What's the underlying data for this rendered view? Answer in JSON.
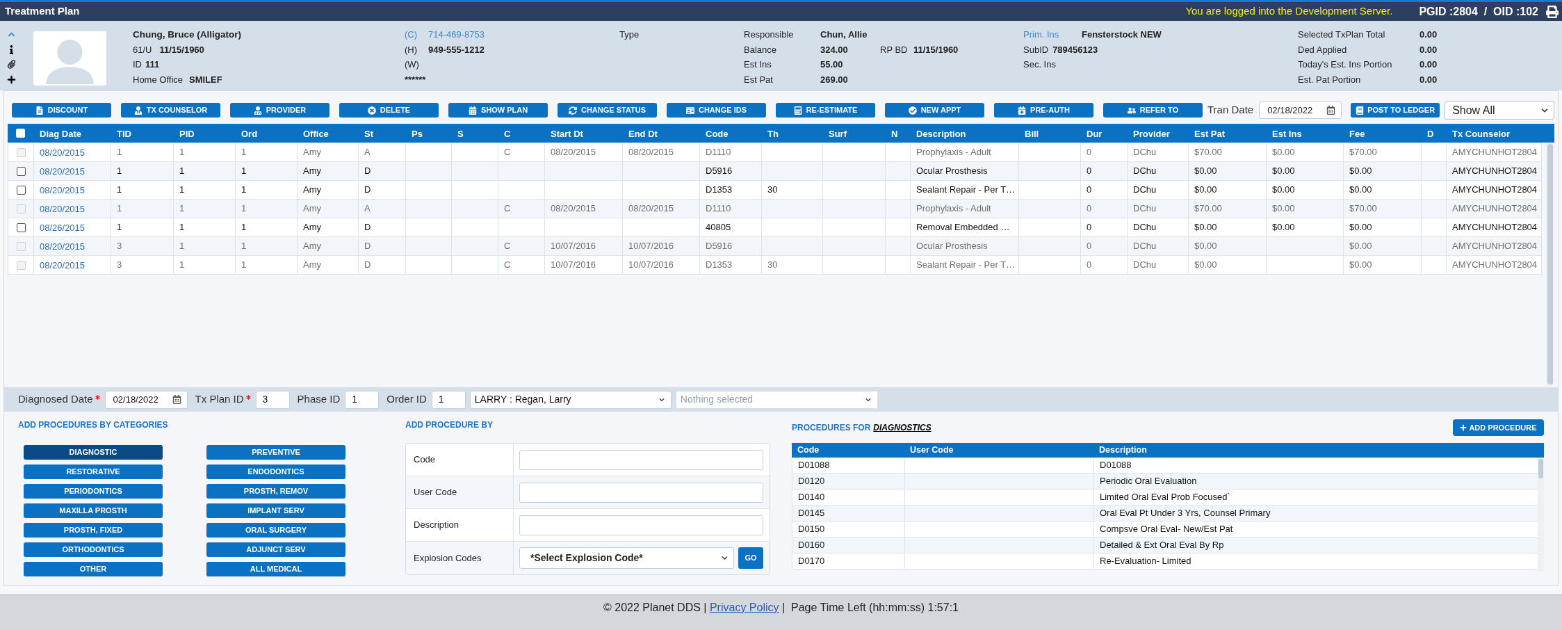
{
  "window": {
    "title": "Treatment Plan",
    "server_notice": "You are logged into the Development Server.",
    "ids": "PGID :2804  /  OID :102"
  },
  "patient": {
    "name": "Chung, Bruce (Alligator)",
    "age": "61/U",
    "dob": "11/15/1960",
    "id_label": "ID",
    "id": "111",
    "office_label": "Home Office",
    "office": "SMILEF"
  },
  "phones": [
    {
      "label": "(C)",
      "value": "714-469-8753",
      "kind": "link"
    },
    {
      "label": "(H)",
      "value": "949-555-1212",
      "kind": "text"
    },
    {
      "label": "(W)",
      "kind": "text"
    },
    {
      "value": "******",
      "kind": "text"
    }
  ],
  "type_label": "Type",
  "account": [
    {
      "label": "Responsible",
      "value": "Chun, Allie"
    },
    {
      "label": "Balance",
      "value": "324.00",
      "extra_label": "RP BD",
      "extra_value": "11/15/1960"
    },
    {
      "label": "Est Ins",
      "value": "55.00"
    },
    {
      "label": "Est Pat",
      "value": "269.00"
    }
  ],
  "insurance": [
    {
      "label": "Prim. Ins",
      "value": "Fensterstock NEW",
      "kind": "link"
    },
    {
      "label": "SubID",
      "value": "789456123",
      "kind": "text"
    },
    {
      "label": "Sec. Ins",
      "kind": "text"
    }
  ],
  "totals": [
    {
      "label": "Selected TxPlan Total",
      "value": "0.00"
    },
    {
      "label": "Ded Applied",
      "value": "0.00"
    },
    {
      "label": "Today's Est. Ins Portion",
      "value": "0.00"
    },
    {
      "label": "Est. Pat Portion",
      "value": "0.00"
    }
  ],
  "toolbar": {
    "buttons": [
      "DISCOUNT",
      "TX COUNSELOR",
      "PROVIDER",
      "DELETE",
      "SHOW PLAN",
      "CHANGE STATUS",
      "CHANGE IDS",
      "RE-ESTIMATE",
      "NEW APPT",
      "PRE-AUTH",
      "REFER TO"
    ],
    "tran_date_label": "Tran Date",
    "tran_date": "02/18/2022",
    "post_button": "POST TO LEDGER",
    "filter": "Show All"
  },
  "table": {
    "select_all": {
      "checked": false
    },
    "columns": [
      "Diag Date",
      "TID",
      "PID",
      "Ord",
      "Office",
      "St",
      "Ps",
      "S",
      "C",
      "Start Dt",
      "End Dt",
      "Code",
      "Th",
      "Surf",
      "N",
      "Description",
      "Bill",
      "Dur",
      "Provider",
      "Est Pat",
      "Est Ins",
      "Fee",
      "D",
      "Tx Counselor"
    ],
    "rows": [
      {
        "checked": false,
        "disabled": true,
        "diag_date": "08/20/2015",
        "tid": "1",
        "pid": "1",
        "ord": "1",
        "office": "Amy",
        "st": "A",
        "c": "C",
        "start_dt": "08/20/2015",
        "end_dt": "08/20/2015",
        "code": "D1110",
        "description": "Prophylaxis - Adult",
        "dur": "0",
        "provider": "DChu",
        "est_pat": "$70.00",
        "est_ins": "$0.00",
        "fee": "$70.00",
        "tx_counselor": "AMYCHUNHOT2804"
      },
      {
        "checked": false,
        "disabled": false,
        "diag_date": "08/20/2015",
        "tid": "1",
        "pid": "1",
        "ord": "1",
        "office": "Amy",
        "st": "D",
        "code": "D5916",
        "description": "Ocular Prosthesis",
        "dur": "0",
        "provider": "DChu",
        "est_pat": "$0.00",
        "est_ins": "$0.00",
        "fee": "$0.00",
        "tx_counselor": "AMYCHUNHOT2804"
      },
      {
        "checked": false,
        "disabled": false,
        "diag_date": "08/20/2015",
        "tid": "1",
        "pid": "1",
        "ord": "1",
        "office": "Amy",
        "st": "D",
        "code": "D1353",
        "th": "30",
        "description": "Sealant Repair - Per T…",
        "dur": "0",
        "provider": "DChu",
        "est_pat": "$0.00",
        "est_ins": "$0.00",
        "fee": "$0.00",
        "tx_counselor": "AMYCHUNHOT2804"
      },
      {
        "checked": false,
        "disabled": true,
        "diag_date": "08/20/2015",
        "tid": "1",
        "pid": "1",
        "ord": "1",
        "office": "Amy",
        "st": "A",
        "c": "C",
        "start_dt": "08/20/2015",
        "end_dt": "08/20/2015",
        "code": "D1110",
        "description": "Prophylaxis - Adult",
        "dur": "0",
        "provider": "DChu",
        "est_pat": "$70.00",
        "est_ins": "$0.00",
        "fee": "$70.00",
        "tx_counselor": "AMYCHUNHOT2804"
      },
      {
        "checked": false,
        "disabled": false,
        "diag_date": "08/26/2015",
        "tid": "1",
        "pid": "1",
        "ord": "1",
        "office": "Amy",
        "st": "D",
        "code": "40805",
        "description": "Removal Embedded …",
        "dur": "0",
        "provider": "DChu",
        "est_pat": "$0.00",
        "est_ins": "$0.00",
        "fee": "$0.00",
        "tx_counselor": "AMYCHUNHOT2804"
      },
      {
        "checked": false,
        "disabled": true,
        "diag_date": "08/20/2015",
        "tid": "3",
        "pid": "1",
        "ord": "1",
        "office": "Amy",
        "st": "D",
        "c": "C",
        "start_dt": "10/07/2016",
        "end_dt": "10/07/2016",
        "code": "D5916",
        "description": "Ocular Prosthesis",
        "dur": "0",
        "provider": "DChu",
        "est_pat": "$0.00",
        "fee": "$0.00",
        "tx_counselor": "AMYCHUNHOT2804"
      },
      {
        "checked": false,
        "disabled": true,
        "diag_date": "08/20/2015",
        "tid": "3",
        "pid": "1",
        "ord": "1",
        "office": "Amy",
        "st": "D",
        "c": "C",
        "start_dt": "10/07/2016",
        "end_dt": "10/07/2016",
        "code": "D1353",
        "th": "30",
        "description": "Sealant Repair - Per T…",
        "dur": "0",
        "provider": "DChu",
        "est_pat": "$0.00",
        "fee": "$0.00",
        "tx_counselor": "AMYCHUNHOT2804"
      }
    ]
  },
  "diag_bar": {
    "fields": [
      {
        "label": "Diagnosed Date",
        "required": true,
        "value": "02/18/2022",
        "kind": "date"
      },
      {
        "label": "Tx Plan ID",
        "required": true,
        "value": "3",
        "kind": "text"
      },
      {
        "label": "Phase ID",
        "value": "1",
        "kind": "text"
      },
      {
        "label": "Order ID",
        "value": "1",
        "kind": "text"
      }
    ],
    "provider": "LARRY : Regan, Larry",
    "secondary_placeholder": "Nothing selected"
  },
  "categories": {
    "title": "ADD PROCEDURES BY CATEGORIES",
    "items": [
      {
        "label": "DIAGNOSTIC",
        "selected": true
      },
      {
        "label": "PREVENTIVE",
        "selected": false
      },
      {
        "label": "RESTORATIVE",
        "selected": false
      },
      {
        "label": "ENDODONTICS",
        "selected": false
      },
      {
        "label": "PERIODONTICS",
        "selected": false
      },
      {
        "label": "PROSTH, REMOV",
        "selected": false
      },
      {
        "label": "MAXILLA PROSTH",
        "selected": false
      },
      {
        "label": "IMPLANT SERV",
        "selected": false
      },
      {
        "label": "PROSTH, FIXED",
        "selected": false
      },
      {
        "label": "ORAL SURGERY",
        "selected": false
      },
      {
        "label": "ORTHODONTICS",
        "selected": false
      },
      {
        "label": "ADJUNCT SERV",
        "selected": false
      },
      {
        "label": "OTHER",
        "selected": false
      },
      {
        "label": "ALL MEDICAL",
        "selected": false
      }
    ]
  },
  "add_procedure": {
    "title": "ADD PROCEDURE BY",
    "fields": [
      {
        "label": "Code",
        "kind": "text"
      },
      {
        "label": "User Code",
        "kind": "text"
      },
      {
        "label": "Description",
        "kind": "text"
      },
      {
        "label": "Explosion Codes",
        "kind": "select",
        "value": "*Select Explosion Code*",
        "button": "GO"
      }
    ]
  },
  "procedures": {
    "title": "PROCEDURES FOR",
    "category": "DIAGNOSTICS",
    "add_button": "ADD PROCEDURE",
    "columns": [
      "Code",
      "User Code",
      "Description"
    ],
    "rows": [
      {
        "code": "D01088",
        "description": "D01088"
      },
      {
        "code": "D0120",
        "description": "Periodic Oral Evaluation"
      },
      {
        "code": "D0140",
        "description": "Limited Oral Eval Prob Focused`"
      },
      {
        "code": "D0145",
        "description": "Oral Eval Pt Under 3 Yrs, Counsel Primary"
      },
      {
        "code": "D0150",
        "description": "Compsve Oral Eval- New/Est Pat"
      },
      {
        "code": "D0160",
        "description": "Detailed & Ext Oral Eval By Rp"
      },
      {
        "code": "D0170",
        "description": "Re-Evaluation- Limited"
      }
    ]
  },
  "footer": {
    "before": "© 2022 Planet DDS | ",
    "link": "Privacy Policy",
    "after": " |  Page Time Left (hh:mm:ss) 1:57:1"
  }
}
